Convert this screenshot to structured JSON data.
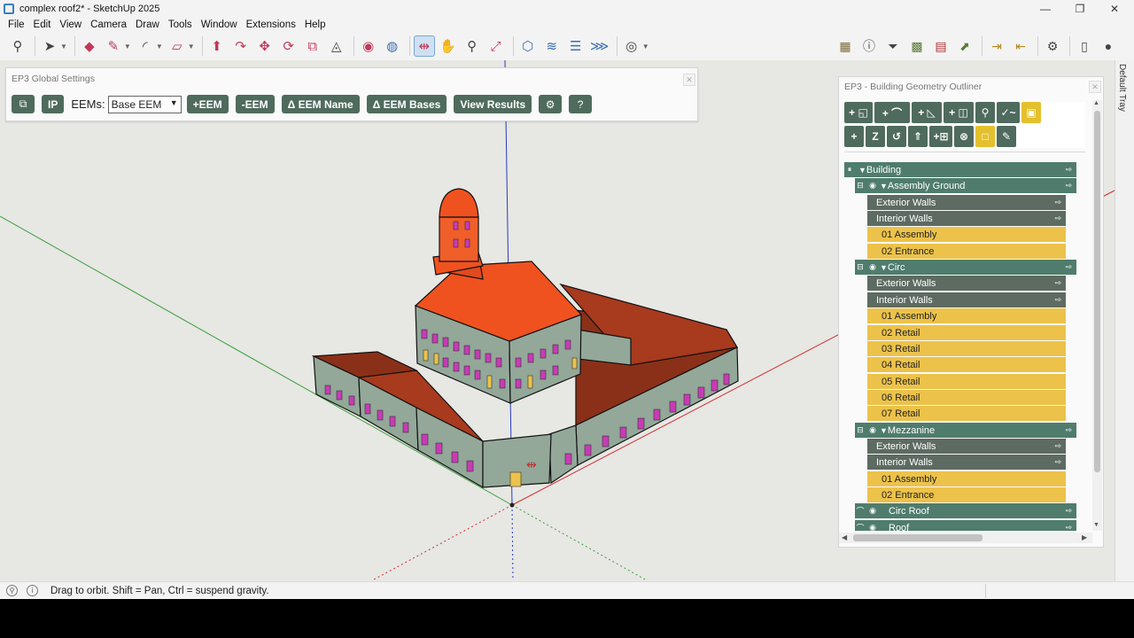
{
  "window": {
    "title": "complex roof2* - SketchUp 2025"
  },
  "menu": [
    "File",
    "Edit",
    "View",
    "Camera",
    "Draw",
    "Tools",
    "Window",
    "Extensions",
    "Help"
  ],
  "global_settings": {
    "title": "EP3 Global Settings",
    "ip_label": "IP",
    "eems_label": "EEMs:",
    "eem_selected": "Base EEM",
    "add_eem": "+EEM",
    "remove_eem": "-EEM",
    "eem_name": "Δ EEM Name",
    "eem_bases": "Δ EEM Bases",
    "view_results": "View Results"
  },
  "outliner": {
    "title": "EP3 - Building Geometry Outliner",
    "tool_row1": [
      "+ ◱",
      "+ ⌒",
      "+ ◺",
      "+ ◫",
      "⚲",
      "✓~"
    ],
    "tool_row2": [
      "+",
      "Z",
      "↺",
      "⇑",
      "+⊞",
      "⊗"
    ],
    "rows": [
      {
        "label": "Building",
        "kind": "g",
        "level": 0
      },
      {
        "label": "Assembly Ground",
        "kind": "g",
        "level": 1
      },
      {
        "label": "Exterior Walls",
        "kind": "s",
        "level": 2
      },
      {
        "label": "Interior Walls",
        "kind": "s",
        "level": 2
      },
      {
        "label": "01 Assembly",
        "kind": "y",
        "level": 3
      },
      {
        "label": "02 Entrance",
        "kind": "y",
        "level": 3
      },
      {
        "label": "Circ",
        "kind": "g",
        "level": 1
      },
      {
        "label": "Exterior Walls",
        "kind": "s",
        "level": 2
      },
      {
        "label": "Interior Walls",
        "kind": "s",
        "level": 2
      },
      {
        "label": "01 Assembly",
        "kind": "y",
        "level": 3
      },
      {
        "label": "02 Retail",
        "kind": "y",
        "level": 3
      },
      {
        "label": "03 Retail",
        "kind": "y",
        "level": 3
      },
      {
        "label": "04 Retail",
        "kind": "y",
        "level": 3
      },
      {
        "label": "05 Retail",
        "kind": "y",
        "level": 3
      },
      {
        "label": "06 Retail",
        "kind": "y",
        "level": 3
      },
      {
        "label": "07 Retail",
        "kind": "y",
        "level": 3
      },
      {
        "label": "Mezzanine",
        "kind": "g",
        "level": 1
      },
      {
        "label": "Exterior Walls",
        "kind": "s",
        "level": 2
      },
      {
        "label": "Interior Walls",
        "kind": "s",
        "level": 2
      },
      {
        "label": "01 Assembly",
        "kind": "y",
        "level": 3
      },
      {
        "label": "02 Entrance",
        "kind": "y",
        "level": 3
      },
      {
        "label": "Circ Roof",
        "kind": "g",
        "level": 1
      },
      {
        "label": "Roof",
        "kind": "g",
        "level": 1
      }
    ]
  },
  "tray": {
    "label": "Default Tray"
  },
  "status": {
    "text": "Drag to orbit. Shift = Pan, Ctrl = suspend gravity."
  },
  "colors": {
    "panel_green": "#4f7c6d",
    "panel_slate": "#5d6b62",
    "zone_yellow": "#ecc24a",
    "roof_orange": "#f0521f",
    "wall_sage": "#93a899",
    "window_magenta": "#c83bb6"
  }
}
